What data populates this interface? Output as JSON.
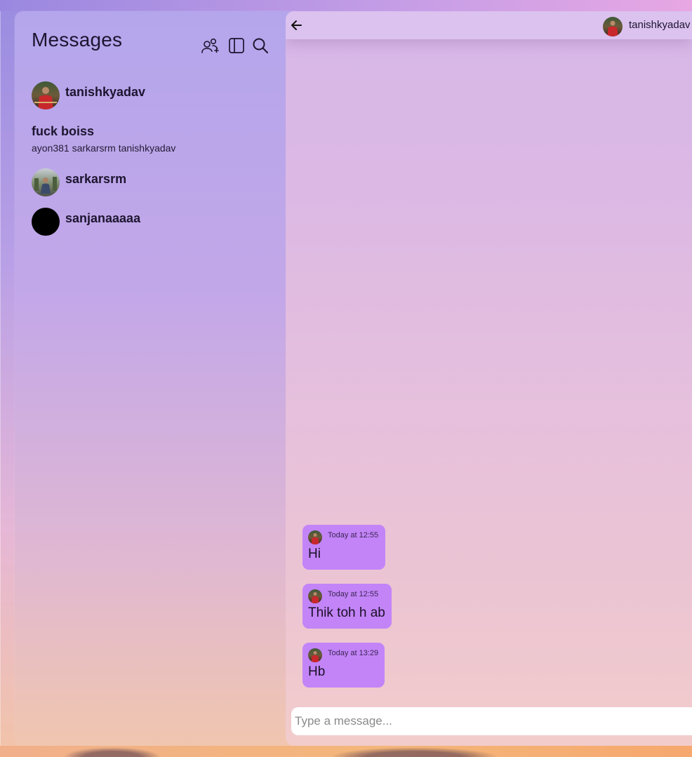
{
  "sidebar": {
    "title": "Messages",
    "icons": [
      "add-group-icon",
      "panel-toggle-icon",
      "search-icon"
    ],
    "chats": [
      {
        "type": "direct",
        "name": "tanishkyadav",
        "avatar": "photo-red-shirt"
      },
      {
        "type": "group",
        "name": "fuck boiss",
        "members": "ayon381 sarkarsrm tanishkyadav"
      },
      {
        "type": "direct",
        "name": "sarkarsrm",
        "avatar": "photo-outdoor"
      },
      {
        "type": "direct",
        "name": "sanjanaaaaa",
        "avatar": "black-circle"
      }
    ]
  },
  "chat": {
    "header": {
      "back_icon": "arrow-left-icon",
      "username": "tanishkyadav"
    },
    "messages": [
      {
        "time": "Today at 12:55",
        "text": "Hi"
      },
      {
        "time": "Today at 12:55",
        "text": "Thik toh h ab"
      },
      {
        "time": "Today at 13:29",
        "text": "Hb"
      }
    ],
    "input": {
      "placeholder": "Type a message...",
      "value": ""
    }
  },
  "colors": {
    "bubble": "#c384f8",
    "text": "#1d1530",
    "accent_bg_top": "#9a8ce0"
  }
}
